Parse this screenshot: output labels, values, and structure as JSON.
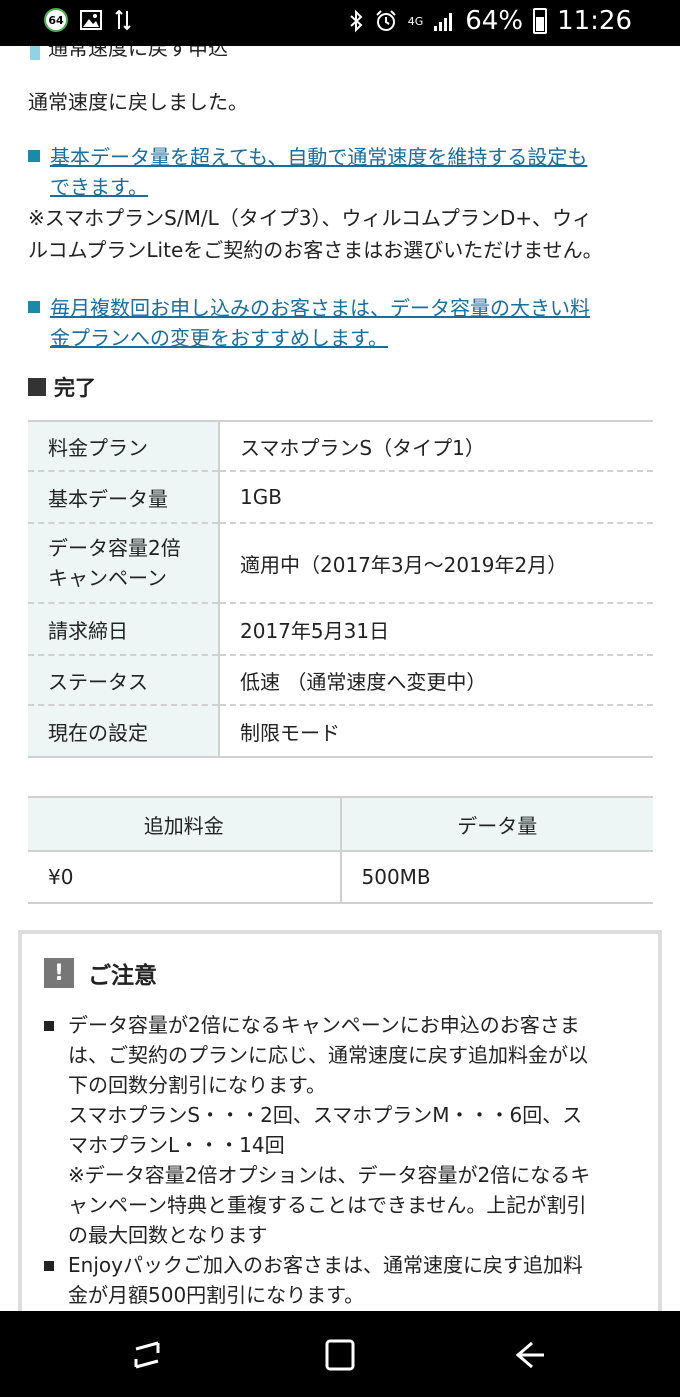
{
  "status_bar": {
    "notification_badge": "64",
    "network": "4G",
    "battery": "64%",
    "time": "11:26"
  },
  "content": {
    "top_heading": "通常速度に戻す申込",
    "restored_message": "通常速度に戻しました。",
    "auto_link_line1": "基本データ量を超えても、自動で通常速度を維持する設定も",
    "auto_link_line2": "できます。",
    "auto_note_line1": "※スマホプランS/M/L（タイプ3）、ウィルコムプランD+、ウィ",
    "auto_note_line2": "ルコムプランLiteをご契約のお客さまはお選びいただけません。",
    "plan_link_line1": "毎月複数回お申し込みのお客さまは、データ容量の大きい料",
    "plan_link_line2": "金プランへの変更をおすすめします。",
    "done_heading": "完了",
    "info_rows": [
      {
        "key": "料金プラン",
        "value": "スマホプランS（タイプ1）"
      },
      {
        "key": "基本データ量",
        "value": "1GB"
      },
      {
        "key": "データ容量2倍キャンペーン",
        "key_line1": "データ容量2倍",
        "key_line2": "キャンペーン",
        "value": "適用中（2017年3月〜2019年2月）"
      },
      {
        "key": "請求締日",
        "value": "2017年5月31日"
      },
      {
        "key": "ステータス",
        "value": "低速 （通常速度へ変更中）"
      },
      {
        "key": "現在の設定",
        "value": "制限モード"
      }
    ],
    "fee_table": {
      "headers": [
        "追加料金",
        "データ量"
      ],
      "row": [
        "¥0",
        "500MB"
      ]
    },
    "caution": {
      "title": "ご注意",
      "item1_lines": [
        "データ容量が2倍になるキャンペーンにお申込のお客さま",
        "は、ご契約のプランに応じ、通常速度に戻す追加料金が以",
        "下の回数分割引になります。",
        "スマホプランS・・・2回、スマホプランM・・・6回、ス",
        "マホプランL・・・14回",
        "※データ容量2倍オプションは、データ容量が2倍になるキ",
        "ャンペーン特典と重複することはできません。上記が割引",
        "の最大回数となります"
      ],
      "item2_lines": [
        "Enjoyパックご加入のお客さまは、通常速度に戻す追加料",
        "金が月額500円割引になります。"
      ]
    }
  },
  "icons": {
    "status_left": [
      "notification-badge",
      "image-icon",
      "sync-icon"
    ],
    "status_right": [
      "bluetooth-icon",
      "alarm-icon",
      "signal-icon",
      "battery-icon"
    ],
    "nav": [
      "recent-apps-icon",
      "home-icon",
      "back-icon"
    ]
  }
}
